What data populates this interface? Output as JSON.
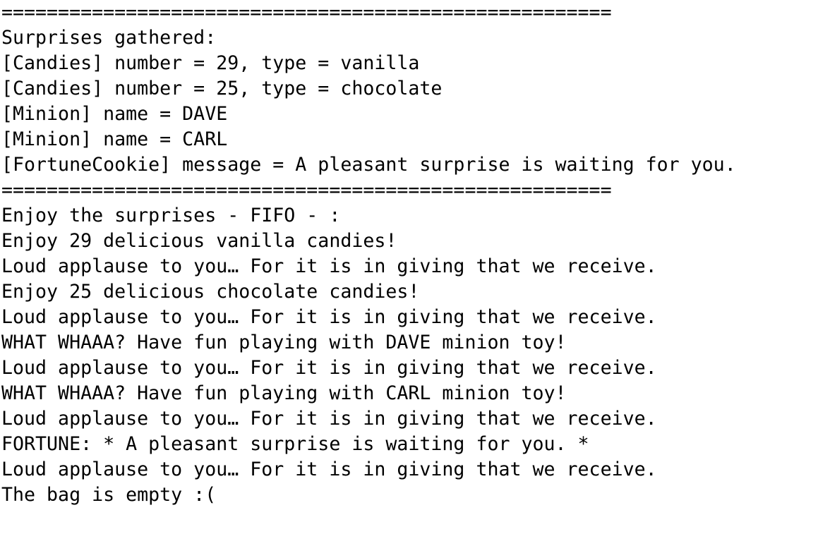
{
  "console": {
    "lines": [
      "======================================================",
      "Surprises gathered:",
      "[Candies] number = 29, type = vanilla",
      "[Candies] number = 25, type = chocolate",
      "[Minion] name = DAVE",
      "[Minion] name = CARL",
      "[FortuneCookie] message = A pleasant surprise is waiting for you.",
      "======================================================",
      "Enjoy the surprises - FIFO - :",
      "Enjoy 29 delicious vanilla candies!",
      "Loud applause to you… For it is in giving that we receive.",
      "Enjoy 25 delicious chocolate candies!",
      "Loud applause to you… For it is in giving that we receive.",
      "WHAT WHAAA? Have fun playing with DAVE minion toy!",
      "Loud applause to you… For it is in giving that we receive.",
      "WHAT WHAAA? Have fun playing with CARL minion toy!",
      "Loud applause to you… For it is in giving that we receive.",
      "FORTUNE: * A pleasant surprise is waiting for you. *",
      "Loud applause to you… For it is in giving that we receive.",
      "The bag is empty :("
    ]
  }
}
